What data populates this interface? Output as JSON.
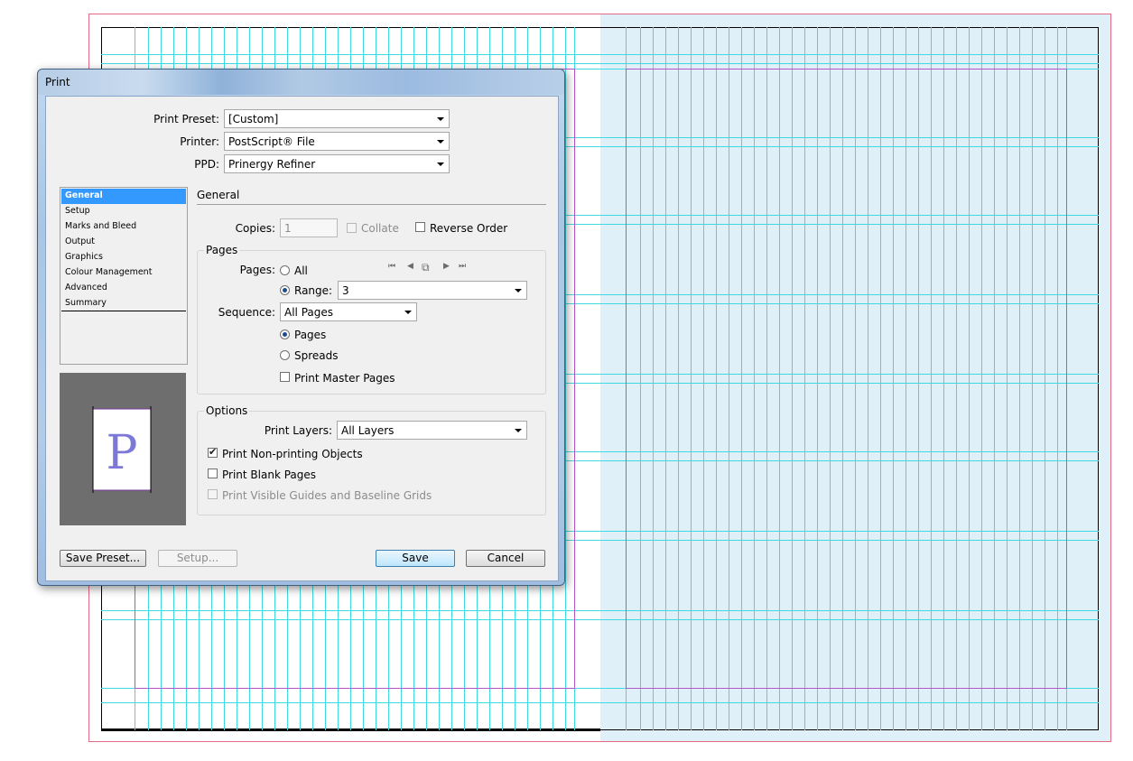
{
  "dialog": {
    "title": "Print",
    "print_preset": {
      "label": "Print Preset:",
      "value": "[Custom]"
    },
    "printer": {
      "label": "Printer:",
      "value": "PostScript® File"
    },
    "ppd": {
      "label": "PPD:",
      "value": "Prinergy Refiner"
    },
    "categories": [
      {
        "label": "General",
        "selected": true
      },
      {
        "label": "Setup"
      },
      {
        "label": "Marks and Bleed"
      },
      {
        "label": "Output"
      },
      {
        "label": "Graphics"
      },
      {
        "label": "Colour Management"
      },
      {
        "label": "Advanced"
      },
      {
        "label": "Summary"
      }
    ],
    "preview": {
      "letter": "P"
    },
    "section_title": "General",
    "copies": {
      "label": "Copies:",
      "value": "1"
    },
    "collate": {
      "label": "Collate",
      "checked": false,
      "enabled": false
    },
    "reverse_order": {
      "label": "Reverse Order",
      "checked": false
    },
    "pages_group": {
      "title": "Pages",
      "pages_label": "Pages:",
      "all_label": "All",
      "range_label": "Range:",
      "range_value": "3",
      "mode": "range",
      "sequence_label": "Sequence:",
      "sequence_value": "All Pages",
      "pages_option": "Pages",
      "spreads_option": "Spreads",
      "layout": "pages",
      "print_master_pages": {
        "label": "Print Master Pages",
        "checked": false
      }
    },
    "options_group": {
      "title": "Options",
      "print_layers_label": "Print Layers:",
      "print_layers_value": "All Layers",
      "print_non_printing": {
        "label": "Print Non-printing Objects",
        "checked": true
      },
      "print_blank_pages": {
        "label": "Print Blank Pages",
        "checked": false
      },
      "print_visible_guides": {
        "label": "Print Visible Guides and Baseline Grids",
        "checked": false,
        "enabled": false
      }
    },
    "buttons": {
      "save_preset": "Save Preset...",
      "setup": "Setup...",
      "save": "Save",
      "cancel": "Cancel"
    }
  },
  "colors": {
    "guide": "#3fd9e0",
    "margin": "#b455c8",
    "bleed": "#e46a86",
    "spread_fill": "#dff0f8",
    "selection": "#3399ff"
  }
}
